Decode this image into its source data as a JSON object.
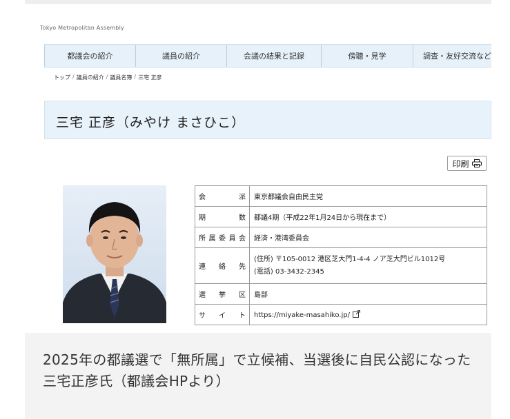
{
  "site": {
    "assembly_name": "Tokyo Metropolitan Assembly"
  },
  "nav": {
    "items": [
      "都議会の紹介",
      "議員の紹介",
      "会議の結果と記録",
      "傍聴・見学",
      "調査・友好交流など"
    ]
  },
  "breadcrumb": [
    "トップ",
    "議員の紹介",
    "議員名簿",
    "三宅 正彦"
  ],
  "page_title": "三宅 正彦（みやけ まさひこ）",
  "print_label": "印刷",
  "profile": {
    "rows": [
      {
        "label": "会派",
        "value": "東京都議会自由民主党"
      },
      {
        "label": "期数",
        "value": "都議4期（平成22年1月24日から現在まで）"
      },
      {
        "label": "所属委員会",
        "value": "経済・港湾委員会"
      },
      {
        "label": "連絡先",
        "address": "(住所) 〒105-0012 港区芝大門1-4-4 ノア芝大門ビル1012号",
        "phone": "(電話) 03-3432-2345"
      },
      {
        "label": "選挙区",
        "value": "島部"
      },
      {
        "label": "サイト",
        "value": "https://miyake-masahiko.jp/"
      }
    ]
  },
  "caption": "2025年の都議選で「無所属」で立候補、当選後に自民公認になった三宅正彦氏（都議会HPより）"
}
